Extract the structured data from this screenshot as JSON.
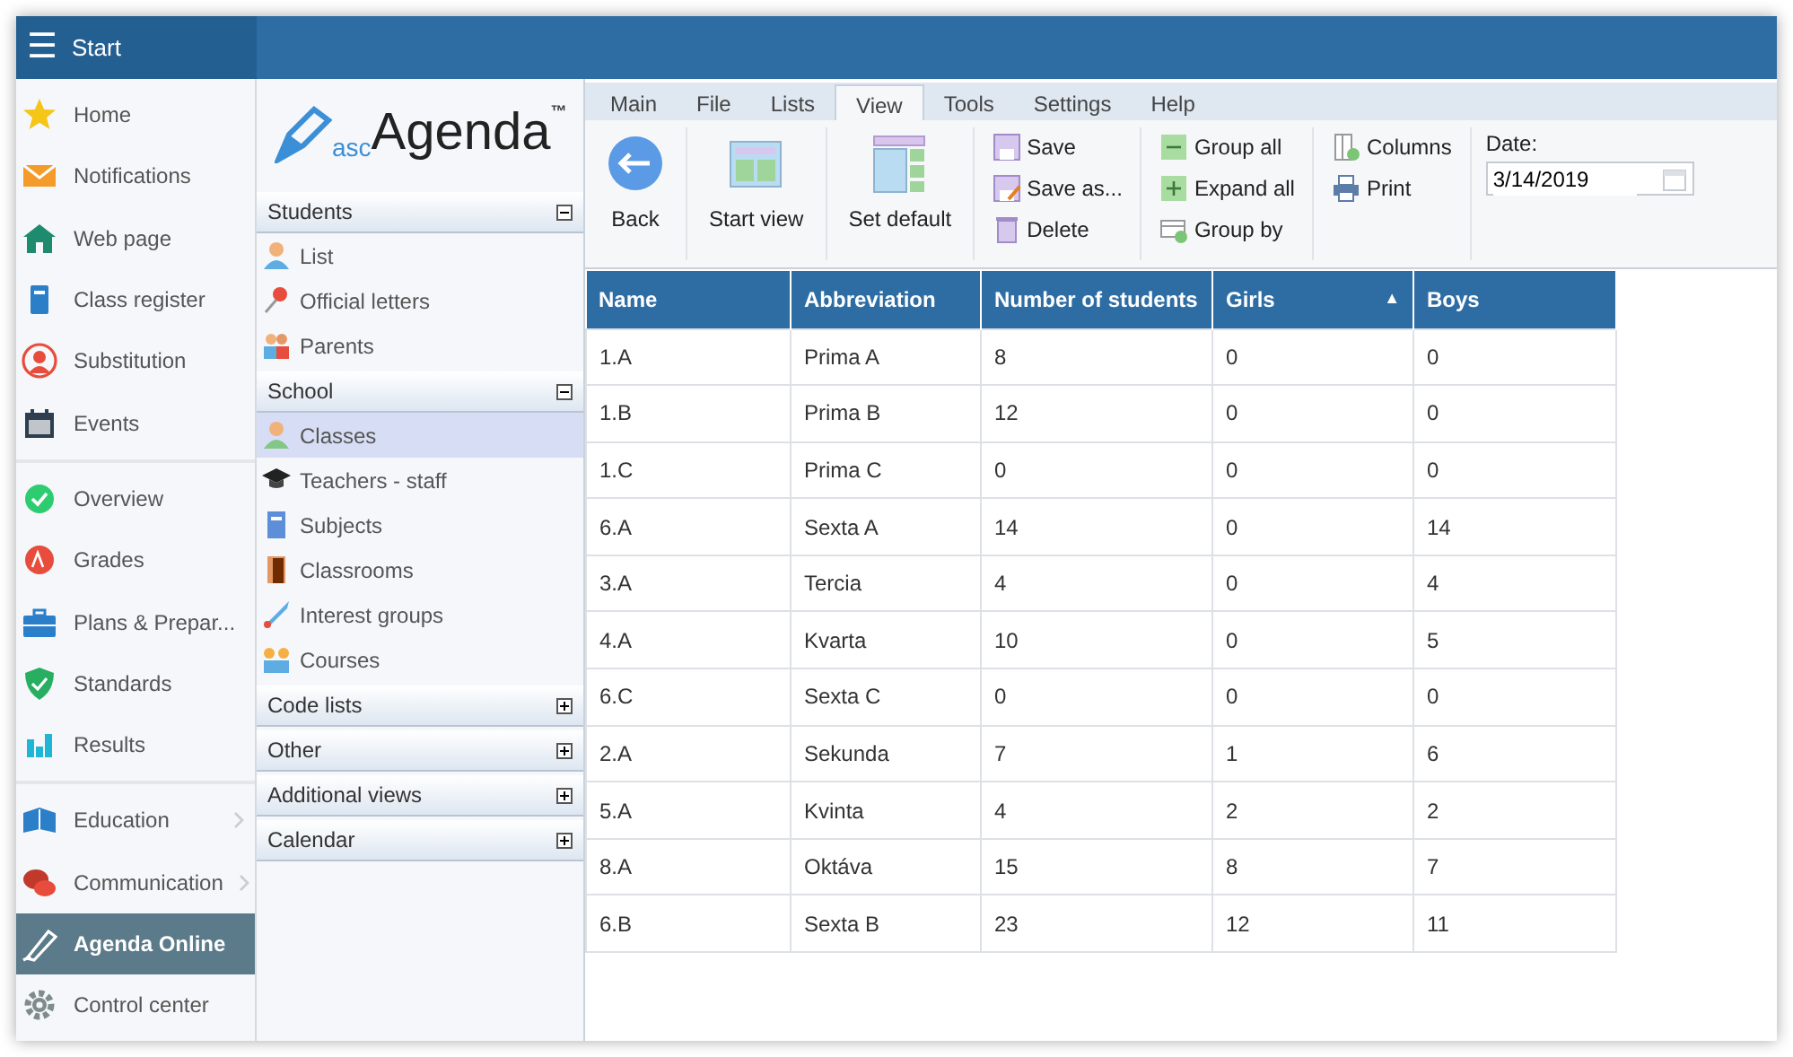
{
  "topbar": {
    "menu_glyph": "☰",
    "title": "Start"
  },
  "nav": {
    "groups": [
      [
        {
          "label": "Home",
          "selected": false,
          "submenu": false
        },
        {
          "label": "Notifications",
          "selected": false,
          "submenu": false
        },
        {
          "label": "Web page",
          "selected": false,
          "submenu": false
        },
        {
          "label": "Class register",
          "selected": false,
          "submenu": false
        },
        {
          "label": "Substitution",
          "selected": false,
          "submenu": false
        },
        {
          "label": "Events",
          "selected": false,
          "submenu": false
        }
      ],
      [
        {
          "label": "Overview",
          "selected": false,
          "submenu": false
        },
        {
          "label": "Grades",
          "selected": false,
          "submenu": false
        },
        {
          "label": "Plans & Prepar...",
          "selected": false,
          "submenu": false
        },
        {
          "label": "Standards",
          "selected": false,
          "submenu": false
        },
        {
          "label": "Results",
          "selected": false,
          "submenu": false
        }
      ],
      [
        {
          "label": "Education",
          "selected": false,
          "submenu": true
        },
        {
          "label": "Communication",
          "selected": false,
          "submenu": true
        },
        {
          "label": "Agenda Online",
          "selected": true,
          "submenu": false
        },
        {
          "label": "Control center",
          "selected": false,
          "submenu": false
        }
      ]
    ]
  },
  "logo": {
    "prefix": "asc",
    "name": "Agenda",
    "mark": "™"
  },
  "sections": [
    {
      "title": "Students",
      "expanded": true,
      "items": [
        {
          "label": "List",
          "selected": false
        },
        {
          "label": "Official letters",
          "selected": false
        },
        {
          "label": "Parents",
          "selected": false
        }
      ]
    },
    {
      "title": "School",
      "expanded": true,
      "items": [
        {
          "label": "Classes",
          "selected": true
        },
        {
          "label": "Teachers - staff",
          "selected": false
        },
        {
          "label": "Subjects",
          "selected": false
        },
        {
          "label": "Classrooms",
          "selected": false
        },
        {
          "label": "Interest groups",
          "selected": false
        },
        {
          "label": "Courses",
          "selected": false
        }
      ]
    },
    {
      "title": "Code lists",
      "expanded": false
    },
    {
      "title": "Other",
      "expanded": false
    },
    {
      "title": "Additional views",
      "expanded": false
    },
    {
      "title": "Calendar",
      "expanded": false
    }
  ],
  "ribbon": {
    "tabs": [
      {
        "label": "Main",
        "selected": false
      },
      {
        "label": "File",
        "selected": false
      },
      {
        "label": "Lists",
        "selected": false
      },
      {
        "label": "View",
        "selected": true
      },
      {
        "label": "Tools",
        "selected": false
      },
      {
        "label": "Settings",
        "selected": false
      },
      {
        "label": "Help",
        "selected": false
      }
    ],
    "groups": [
      {
        "kind": "large",
        "buttons": [
          "Back"
        ]
      },
      {
        "kind": "large",
        "buttons": [
          "Start view"
        ]
      },
      {
        "kind": "large",
        "buttons": [
          "Set default"
        ]
      },
      {
        "kind": "small",
        "buttons": [
          "Save",
          "Save as...",
          "Delete"
        ]
      },
      {
        "kind": "small",
        "buttons": [
          "Group all",
          "Expand all",
          "Group by"
        ]
      },
      {
        "kind": "small",
        "buttons": [
          "Columns",
          "Print"
        ]
      }
    ],
    "date": {
      "label": "Date:",
      "value": "3/14/2019"
    }
  },
  "table": {
    "columns": [
      {
        "label": "Name"
      },
      {
        "label": "Abbreviation"
      },
      {
        "label": "Number of students"
      },
      {
        "label": "Girls",
        "sort_glyph": "▲"
      },
      {
        "label": "Boys"
      }
    ],
    "rows": [
      [
        "1.A",
        "Prima A",
        "8",
        "0",
        "0"
      ],
      [
        "1.B",
        "Prima B",
        "12",
        "0",
        "0"
      ],
      [
        "1.C",
        "Prima C",
        "0",
        "0",
        "0"
      ],
      [
        "6.A",
        "Sexta A",
        "14",
        "0",
        "14"
      ],
      [
        "3.A",
        "Tercia",
        "4",
        "0",
        "4"
      ],
      [
        "4.A",
        "Kvarta",
        "10",
        "0",
        "5"
      ],
      [
        "6.C",
        "Sexta C",
        "0",
        "0",
        "0"
      ],
      [
        "2.A",
        "Sekunda",
        "7",
        "1",
        "6"
      ],
      [
        "5.A",
        "Kvinta",
        "4",
        "2",
        "2"
      ],
      [
        "8.A",
        "Oktáva",
        "15",
        "8",
        "7"
      ],
      [
        "6.B",
        "Sexta B",
        "23",
        "12",
        "11"
      ]
    ]
  }
}
